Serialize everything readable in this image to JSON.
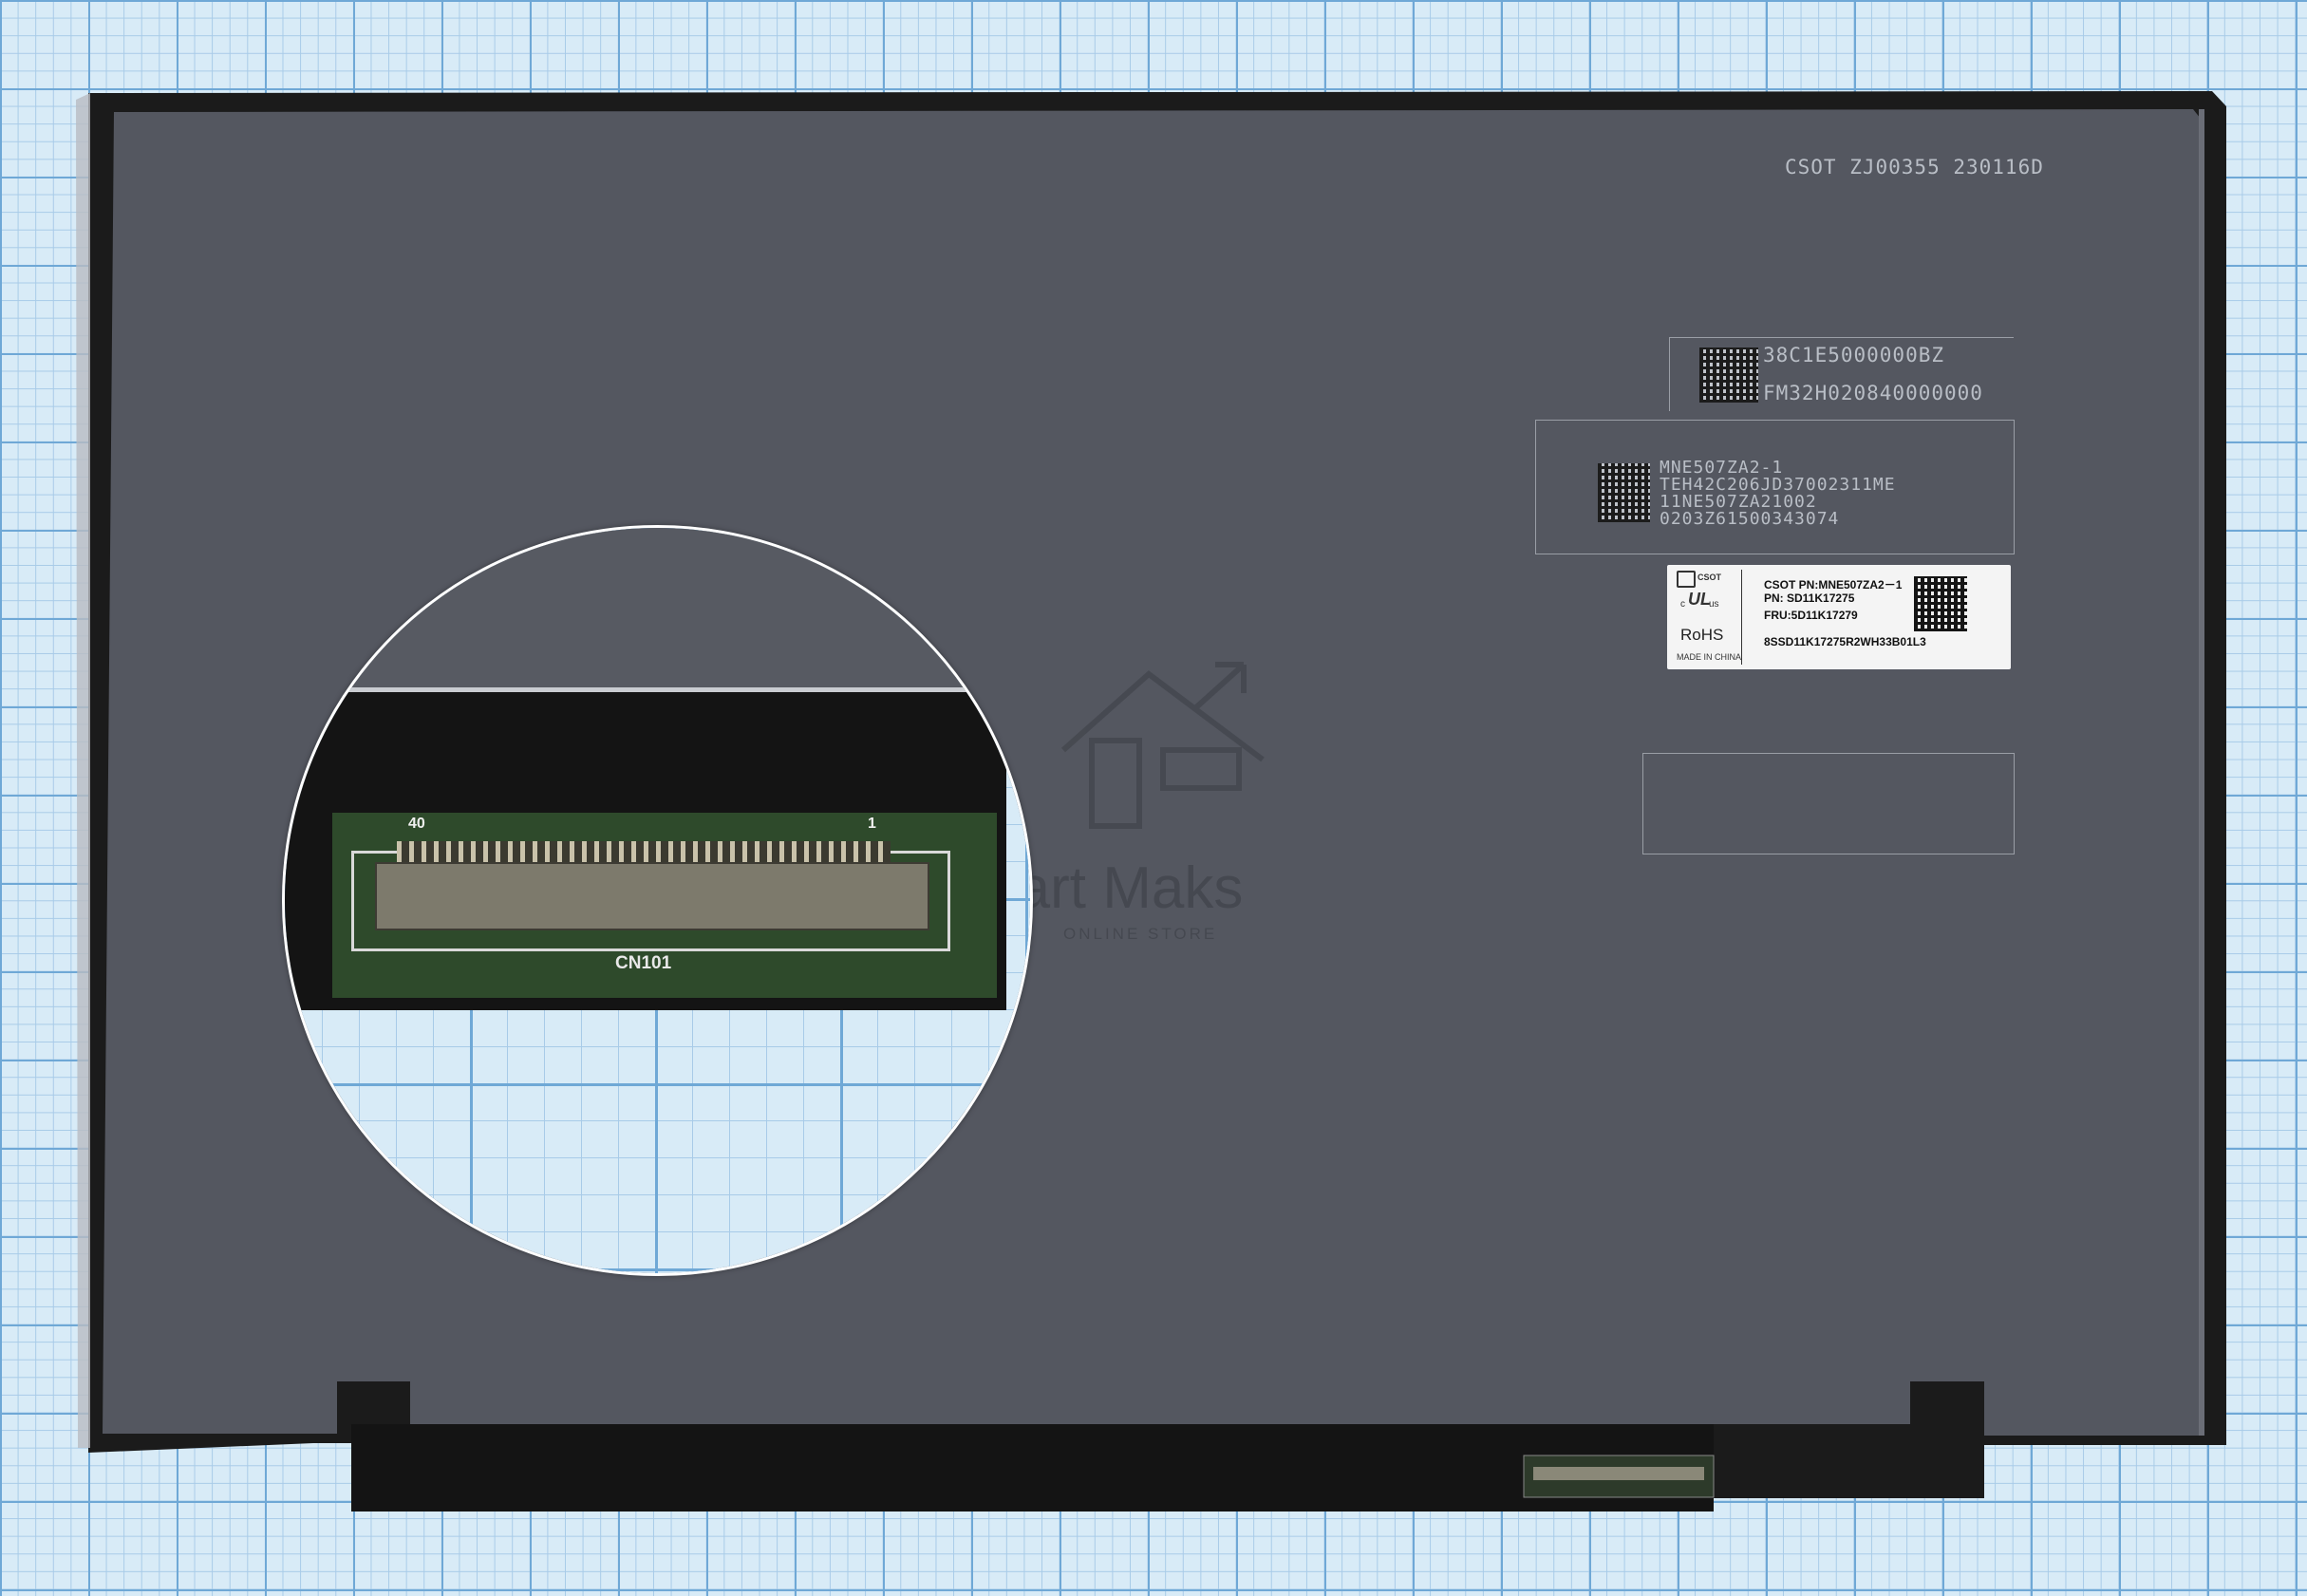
{
  "panel": {
    "top_code": "CSOT ZJ00355 230116D",
    "serial_block_1": [
      "38C1E5000000BZ",
      "FM32H020840000000"
    ],
    "serial_block_2": [
      "MNE507ZA2-1",
      "TEH42C206JD37002311ME",
      "11NE507ZA21002",
      "0203Z61500343074"
    ]
  },
  "label": {
    "brand": "CSOT",
    "pn_csot": "CSOT PN:MNE507ZA2－1",
    "pn": "PN: SD11K17275",
    "fru": "FRU:5D11K17279",
    "barcode_text": "8SSD11K17275R2WH33B01L3",
    "rohs": "RoHS",
    "made_in": "MADE IN CHINA",
    "ul_c": "c",
    "ul_us": "us"
  },
  "connector": {
    "pin_left": "40",
    "pin_right": "1",
    "name": "CN101"
  },
  "watermark": {
    "brand": "Mart Maks",
    "sub": "ONLINE STORE"
  },
  "colors": {
    "panel": "#545760",
    "bezel": "#161616",
    "pcb": "#2e4a2b",
    "grid": "#d8ebf7"
  }
}
